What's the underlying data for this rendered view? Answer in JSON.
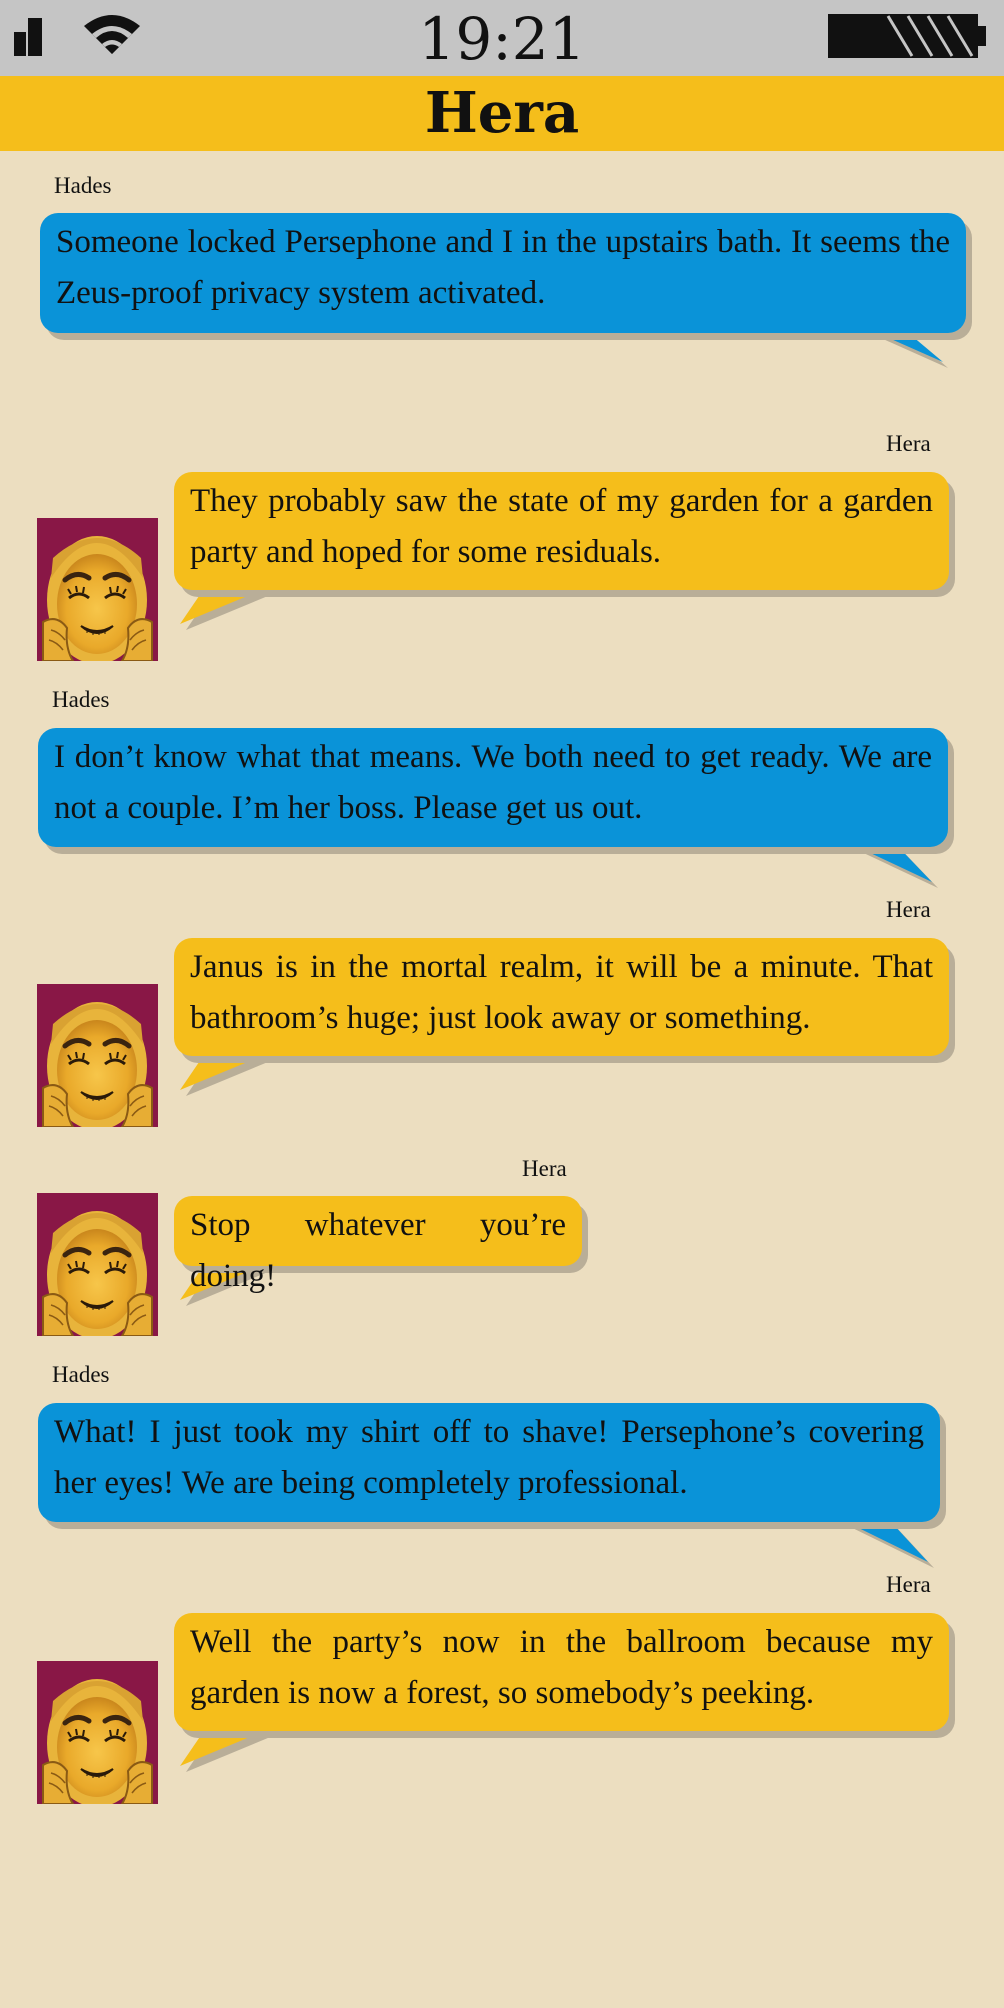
{
  "status": {
    "time": "19:21"
  },
  "header": {
    "title": "Hera"
  },
  "colors": {
    "hades_bubble": "#0a93d8",
    "hera_bubble": "#f5be1b",
    "background": "#ecdec0",
    "status_bar": "#c5c5c5"
  },
  "icons": {
    "signal": "signal-icon",
    "wifi": "wifi-icon",
    "battery": "battery-icon",
    "avatar": "hera-avatar"
  },
  "messages": [
    {
      "sender": "Hades",
      "text": "Someone locked Persephone and I in the upstairs bath. It seems the Zeus-proof privacy system activated."
    },
    {
      "sender": "Hera",
      "text": "They probably saw the state of my garden for a garden party and hoped for some residuals."
    },
    {
      "sender": "Hades",
      "text": "I don’t know what that means. We both need to get ready. We are not a couple. I’m her boss. Please get us out."
    },
    {
      "sender": "Hera",
      "text": "Janus is in the mortal realm, it will be a minute. That bathroom’s huge; just look away or something."
    },
    {
      "sender": "Hera",
      "text": "Stop whatever you’re doing!"
    },
    {
      "sender": "Hades",
      "text": "What! I just took my shirt off to shave! Persephone’s covering her eyes! We are being completely professional."
    },
    {
      "sender": "Hera",
      "text": "Well the party’s now in the ballroom because my garden is now a forest, so somebody’s peeking."
    }
  ]
}
